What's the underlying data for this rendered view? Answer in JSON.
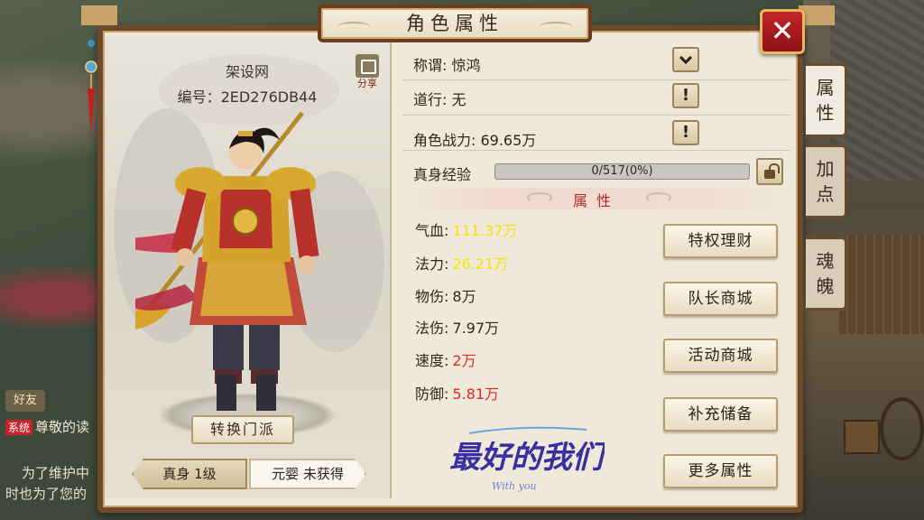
{
  "title": "角色属性",
  "close_label": "✕",
  "left": {
    "server_name": "架设网",
    "player_id": "编号：2ED276DB44",
    "share_label": "分享",
    "switch_button": "转换门派",
    "tabs": [
      {
        "label": "真身 1级",
        "active": true
      },
      {
        "label": "元婴 未获得",
        "active": false
      }
    ]
  },
  "info": {
    "title_row": "称谓: 惊鸿",
    "daoxing_row": "道行: 无",
    "power_row": "角色战力: 69.65万",
    "exp_label": "真身经验",
    "exp_text": "0/517(0%)",
    "exp_progress": 0,
    "dropdown_icon": "chevron-down-icon",
    "info_icon": "!"
  },
  "attributes": {
    "header": "属性",
    "items": [
      {
        "label": "气血:",
        "value": "111.37万",
        "color": "#f5e300"
      },
      {
        "label": "法力:",
        "value": "26.21万",
        "color": "#f5e300"
      },
      {
        "label": "物伤:",
        "value": "8万",
        "color": "#2f261d"
      },
      {
        "label": "法伤:",
        "value": "7.97万",
        "color": "#2f261d"
      },
      {
        "label": "速度:",
        "value": "2万",
        "color": "#e3281d"
      },
      {
        "label": "防御:",
        "value": "5.81万",
        "color": "#e3281d"
      }
    ]
  },
  "buttons": [
    "特权理财",
    "队长商城",
    "活动商城",
    "补充储备",
    "更多属性"
  ],
  "side_tabs": [
    {
      "label": "属\n性",
      "active": true
    },
    {
      "label": "加\n点",
      "active": false
    },
    {
      "label": "魂\n魄",
      "active": false
    }
  ],
  "logo": {
    "main": "最好的我们",
    "sub": "With you"
  },
  "background_ui": {
    "friend_label": "好友",
    "chat_tag": "系统",
    "chat_line1": "尊敬的读",
    "chat_line2": "为了维护中",
    "chat_line3": "时也为了您的"
  }
}
